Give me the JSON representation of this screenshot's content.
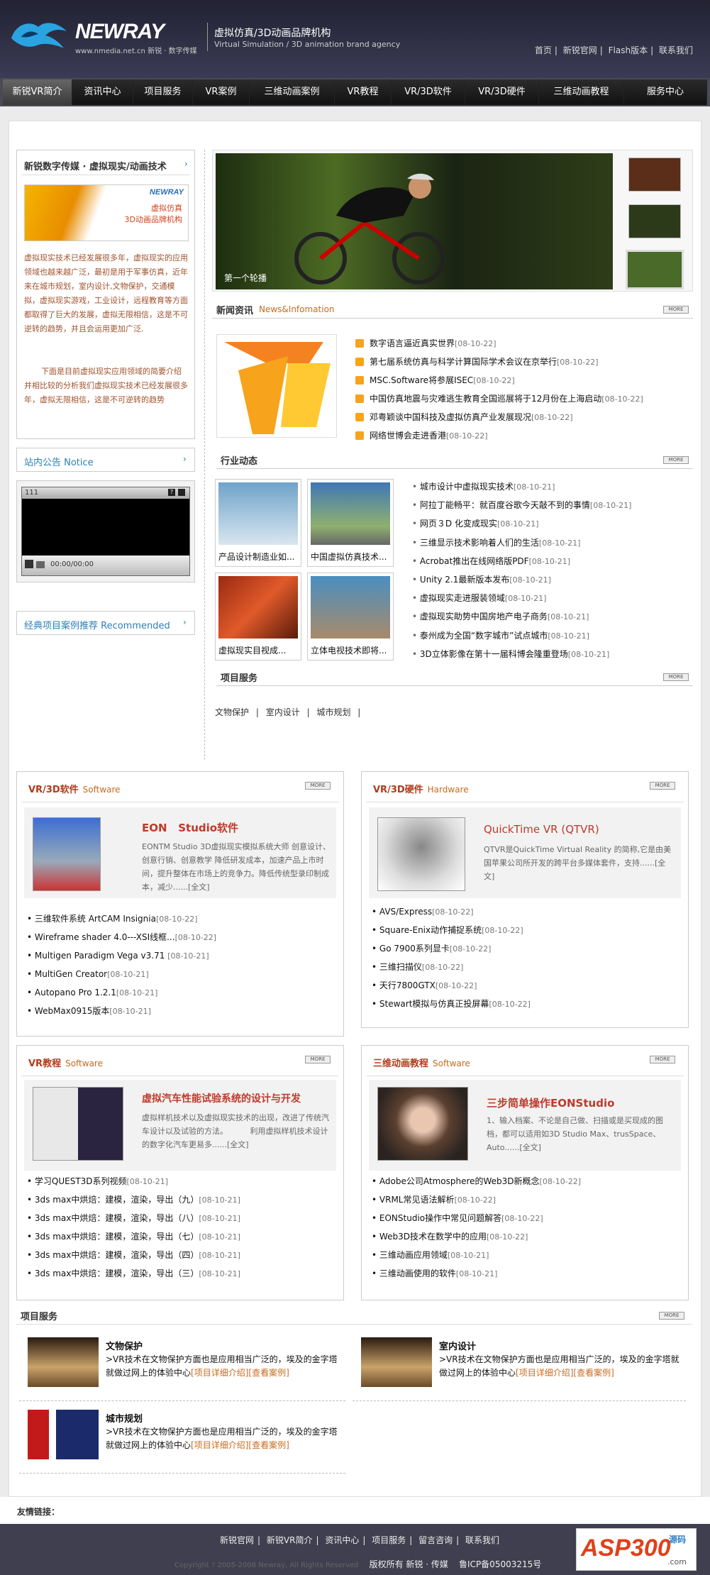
{
  "header": {
    "brand": "NEWRAY",
    "brand_sub": "www.nmedia.net.cn 新锐 · 数字传媒",
    "tag_cn": "虚拟仿真/3D动画品牌机构",
    "tag_en": "Virtual Simulation / 3D animation brand agency",
    "links": [
      "首页",
      "新锐官网",
      "Flash版本",
      "联系我们"
    ]
  },
  "nav": [
    "新锐VR简介",
    "资讯中心",
    "项目服务",
    "VR案例",
    "三维动画案例",
    "VR教程",
    "VR/3D软件",
    "VR/3D硬件",
    "三维动画教程",
    "服务中心"
  ],
  "about": {
    "title": "新锐数字传媒 · 虚拟现实/动画技术",
    "banner_brand": "NEWRAY",
    "banner_l1": "虚拟仿真",
    "banner_l2": "3D动画品牌机构",
    "p1": "虚拟现实技术已经发展很多年，虚拟现实的应用领域也越来越广泛，最初是用于军事仿真，近年来在城市规划，室内设计,文物保护，交通模拟，虚拟现实游戏，工业设计，远程教育等方面都取得了巨大的发展，虚拟无限相信，这是不可逆转的趋势，并且会运用更加广泛.",
    "p2": "下面是目前虚拟现实应用领域的简要介绍并相比较的分析我们虚拟现实技术已经发展很多年，虚拟无限相信，这是不可逆转的趋势"
  },
  "notice": {
    "title": "站内公告 Notice",
    "player_label": "111",
    "player_time": "00:00/00:00"
  },
  "recommend": {
    "title": "经典项目案例推荐 Recommended"
  },
  "slider": {
    "caption": "第一个轮播"
  },
  "news": {
    "title": "新闻资讯",
    "en": "News&Infomation",
    "more": "MORE",
    "items": [
      {
        "t": "数字语言逼近真实世界",
        "d": "[08-10-22]"
      },
      {
        "t": "第七届系统仿真与科学计算国际学术会议在京举行",
        "d": "[08-10-22]"
      },
      {
        "t": "MSC.Software将参展ISEC",
        "d": "[08-10-22]"
      },
      {
        "t": "中国仿真地震与灾难逃生教育全国巡展将于12月份在上海启动",
        "d": "[08-10-22]"
      },
      {
        "t": "邓粤颖谈中国科技及虚拟仿真产业发展现况",
        "d": "[08-10-22]"
      },
      {
        "t": "网络世博会走进香港",
        "d": "[08-10-22]"
      }
    ]
  },
  "industry": {
    "title": "行业动态",
    "more": "MORE",
    "thumbs": [
      "产品设计制造业如...",
      "中国虚拟仿真技术...",
      "虚拟现实目视成...",
      "立体电视技术即将..."
    ],
    "items": [
      {
        "t": "城市设计中虚拟现实技术",
        "d": "[08-10-21]"
      },
      {
        "t": "阿拉丁能畅平：就百度谷歌今天敲不到的事情",
        "d": "[08-10-21]"
      },
      {
        "t": "网页３D 化变成现实",
        "d": "[08-10-21]"
      },
      {
        "t": "三维显示技术影响着人们的生活",
        "d": "[08-10-21]"
      },
      {
        "t": "Acrobat推出在线网络版PDF",
        "d": "[08-10-21]"
      },
      {
        "t": "Unity 2.1最新版本发布",
        "d": "[08-10-21]"
      },
      {
        "t": "虚拟现实走进服装领域",
        "d": "[08-10-21]"
      },
      {
        "t": "虚拟现实助势中国房地产电子商务",
        "d": "[08-10-21]"
      },
      {
        "t": "泰州成为全国“数字城市”试点城市",
        "d": "[08-10-21]"
      },
      {
        "t": "3D立体影像在第十一届科博会隆重登场",
        "d": "[08-10-21]"
      }
    ]
  },
  "services_small": {
    "title": "项目服务",
    "more": "MORE",
    "links": [
      "文物保护",
      "室内设计",
      "城市规划"
    ]
  },
  "soft": {
    "title": "VR/3D软件",
    "en": "Software",
    "more": "MORE",
    "feat_title": "EON   Studio软件",
    "feat_text": "EONTM Studio 3D虚拟现实模拟系统大师 创意设计、创意行销、创意教学 降低研发成本，加速产品上市时间，提升整体在市场上的竞争力。降低传统型录印制成本，减少......[全文]",
    "items": [
      {
        "t": "三维软件系统 ArtCAM Insignia",
        "d": "[08-10-22]"
      },
      {
        "t": "Wireframe shader 4.0---XSI线框...",
        "d": "[08-10-22]"
      },
      {
        "t": "Multigen Paradigm Vega v3.71 ",
        "d": "[08-10-21]"
      },
      {
        "t": "MultiGen Creator",
        "d": "[08-10-21]"
      },
      {
        "t": "Autopano Pro 1.2.1",
        "d": "[08-10-21]"
      },
      {
        "t": "WebMax0915版本",
        "d": "[08-10-21]"
      }
    ]
  },
  "hard": {
    "title": "VR/3D硬件",
    "en": "Hardware",
    "more": "MORE",
    "feat_title": "QuickTime VR (QTVR)",
    "feat_text": "QTVR是QuickTime Virtual Reality 的简称,它是由美国苹果公司所开发的跨平台多媒体套件，支持......[全文]",
    "items": [
      {
        "t": "AVS/Express",
        "d": "[08-10-22]"
      },
      {
        "t": "Square-Enix动作捕捉系统",
        "d": "[08-10-22]"
      },
      {
        "t": "Go 7900系列显卡",
        "d": "[08-10-22]"
      },
      {
        "t": "三维扫描仪",
        "d": "[08-10-22]"
      },
      {
        "t": "天行7800GTX",
        "d": "[08-10-22]"
      },
      {
        "t": "Stewart模拟与仿真正投屏幕",
        "d": "[08-10-22]"
      }
    ]
  },
  "vrtut": {
    "title": "VR教程",
    "en": "Software",
    "more": "MORE",
    "feat_title": "虚拟汽车性能试验系统的设计与开发",
    "feat_text": "虚拟样机技术以及虚拟现实技术的出现，改进了传统汽车设计以及试验的方法。         利用虚拟样机技术设计的数字化汽车更易多......[全文]",
    "items": [
      {
        "t": "学习QUEST3D系列视频",
        "d": "[08-10-21]"
      },
      {
        "t": "3ds max中烘焙：建模，渲染，导出（九）",
        "d": "[08-10-21]"
      },
      {
        "t": "3ds max中烘焙：建模，渲染，导出（八）",
        "d": "[08-10-21]"
      },
      {
        "t": "3ds max中烘焙：建模，渲染，导出（七）",
        "d": "[08-10-21]"
      },
      {
        "t": "3ds max中烘焙：建模，渲染，导出（四）",
        "d": "[08-10-21]"
      },
      {
        "t": "3ds max中烘焙：建模，渲染，导出（三）",
        "d": "[08-10-21]"
      }
    ]
  },
  "animtut": {
    "title": "三维动画教程",
    "en": "Software",
    "more": "MORE",
    "feat_title": "三步简单操作EONStudio",
    "feat_text": "1、输入档案、不论是自己做、扫描或是买现成的图档，都可以适用如3D Studio Max、trusSpace、Auto......[全文]",
    "items": [
      {
        "t": "Adobe公司Atmosphere的Web3D新概念",
        "d": "[08-10-22]"
      },
      {
        "t": "VRML常见语法解析",
        "d": "[08-10-22]"
      },
      {
        "t": "EONStudio操作中常见问题解答",
        "d": "[08-10-22]"
      },
      {
        "t": "Web3D技术在数学中的应用",
        "d": "[08-10-22]"
      },
      {
        "t": "三维动画应用领域",
        "d": "[08-10-21]"
      },
      {
        "t": "三维动画使用的软件",
        "d": "[08-10-21]"
      }
    ]
  },
  "services": {
    "title": "项目服务",
    "more": "MORE",
    "items": [
      {
        "name": "文物保护",
        "text": ">VR技术在文物保护方面也是应用相当广泛的，埃及的金字塔就做过网上的体验中心",
        "l1": "[项目详细介绍]",
        "l2": "[查看案例]"
      },
      {
        "name": "室内设计",
        "text": ">VR技术在文物保护方面也是应用相当广泛的，埃及的金字塔就做过网上的体验中心",
        "l1": "[项目详细介绍]",
        "l2": "[查看案例]"
      },
      {
        "name": "城市规划",
        "text": ">VR技术在文物保护方面也是应用相当广泛的，埃及的金字塔就做过网上的体验中心",
        "l1": "[项目详细介绍]",
        "l2": "[查看案例]"
      }
    ]
  },
  "friend": {
    "label": "友情链接："
  },
  "footer": {
    "links": [
      "新锐官网",
      "新锐VR简介",
      "资讯中心",
      "项目服务",
      "留言咨询",
      "联系我们"
    ],
    "copy": "Copyright ? 2005-2008 Newray, All Rights Reserved",
    "rights": "版权所有 新锐 · 传媒",
    "icp": "鲁ICP备05003215号",
    "badge": "ASP300",
    "badge_sub": "源码",
    "badge_url": ".com"
  }
}
